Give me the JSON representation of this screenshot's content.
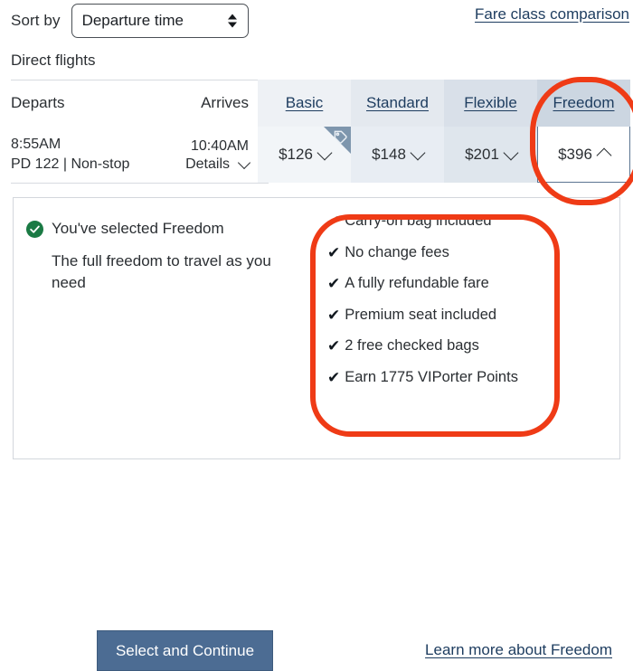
{
  "sort_bar": {
    "label": "Sort by",
    "select_value": "Departure time",
    "select_options": [
      "Departure time"
    ],
    "stepper_icon": "stepper-up-down-icon"
  },
  "fare_class_comparison_link": "Fare class comparison",
  "direct_flights_label": "Direct flights",
  "table": {
    "headers": {
      "departs": "Departs",
      "arrives": "Arrives",
      "fare_classes": [
        "Basic",
        "Standard",
        "Flexible",
        "Freedom"
      ]
    },
    "flight": {
      "depart_time": "8:55AM",
      "arrive_time": "10:40AM",
      "flight_number": "PD 122",
      "separator": "|",
      "stops": "Non-stop",
      "details_label": "Details",
      "details_chevron_icon": "chevron-down-icon"
    },
    "prices": [
      {
        "fare": "Basic",
        "price": "$126",
        "chevron_icon": "chevron-down-icon",
        "expanded": false,
        "ribbon_icon": "price-tag-icon"
      },
      {
        "fare": "Standard",
        "price": "$148",
        "chevron_icon": "chevron-down-icon",
        "expanded": false
      },
      {
        "fare": "Flexible",
        "price": "$201",
        "chevron_icon": "chevron-down-icon",
        "expanded": false
      },
      {
        "fare": "Freedom",
        "price": "$396",
        "chevron_icon": "chevron-up-icon",
        "expanded": true
      }
    ]
  },
  "fare_panel": {
    "selected_check_icon": "check-circle-icon",
    "selected_text": "You've selected Freedom",
    "description": "The full freedom to travel as you need",
    "benefit_check_icon": "checkmark-icon",
    "benefits": [
      "Carry-on bag included",
      "No change fees",
      "A fully refundable fare",
      "Premium seat included",
      "2 free checked bags",
      "Earn 1775 VIPorter Points"
    ]
  },
  "footer": {
    "select_continue_label": "Select and Continue",
    "learn_more_label": "Learn more about Freedom"
  },
  "colors": {
    "link_blue": "#1d3c5f",
    "button_blue": "#4c6c93",
    "selected_green": "#1a7a44",
    "annotation_red": "#ef3b16",
    "freedom_header": "#ccd6e1"
  }
}
